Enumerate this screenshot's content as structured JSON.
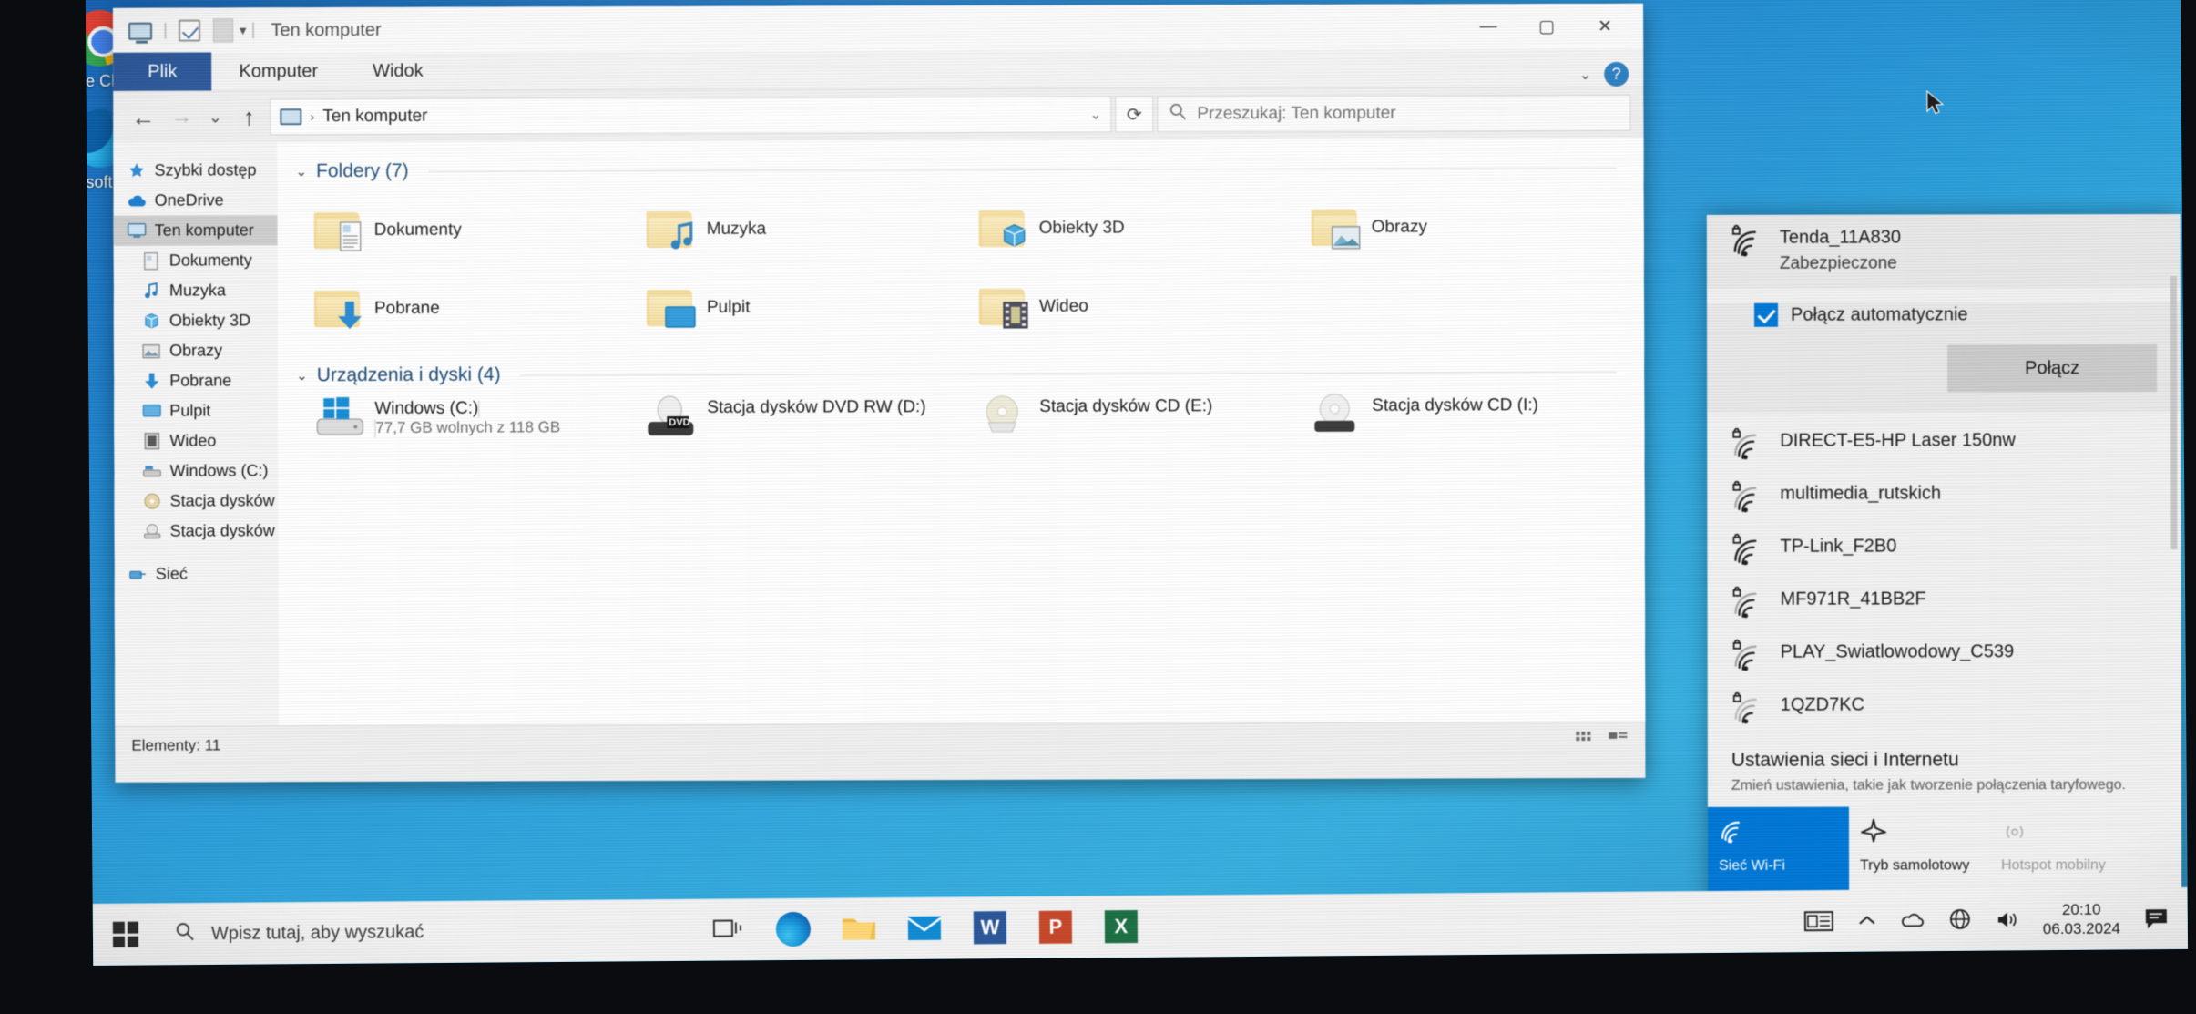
{
  "desktop": {
    "icons": [
      {
        "name": "Google Chrome",
        "icon": "chrome-icon"
      },
      {
        "name": "Microsoft Edge",
        "icon": "edge-icon"
      }
    ]
  },
  "explorer": {
    "titlebar": {
      "title": "Ten komputer",
      "quick_access_icons": [
        "this-pc-icon",
        "properties-icon",
        "new-folder-icon"
      ],
      "dropdown_caret": "▾",
      "separator": "|",
      "minimize": "—",
      "maximize": "▢",
      "close": "✕"
    },
    "ribbon": {
      "tabs": [
        {
          "label": "Plik",
          "active": true
        },
        {
          "label": "Komputer",
          "active": false
        },
        {
          "label": "Widok",
          "active": false
        }
      ],
      "collapse_caret": "⌄",
      "help_label": "?"
    },
    "address_bar": {
      "back": "←",
      "forward": "→",
      "recent": "⌄",
      "up": "↑",
      "path_icon": "this-pc-icon",
      "path_separator": "›",
      "path": "Ten komputer",
      "history_caret": "⌄",
      "refresh": "⟳"
    },
    "search": {
      "icon": "search-icon",
      "placeholder": "Przeszukaj: Ten komputer",
      "value": ""
    },
    "nav_pane": [
      {
        "label": "Szybki dostęp",
        "icon": "star-icon",
        "indent": false,
        "selected": false
      },
      {
        "label": "OneDrive",
        "icon": "cloud-icon",
        "indent": false,
        "selected": false
      },
      {
        "label": "Ten komputer",
        "icon": "this-pc-icon",
        "indent": false,
        "selected": true
      },
      {
        "label": "Dokumenty",
        "icon": "documents-icon",
        "indent": true,
        "selected": false
      },
      {
        "label": "Muzyka",
        "icon": "music-icon",
        "indent": true,
        "selected": false
      },
      {
        "label": "Obiekty 3D",
        "icon": "3d-objects-icon",
        "indent": true,
        "selected": false
      },
      {
        "label": "Obrazy",
        "icon": "pictures-icon",
        "indent": true,
        "selected": false
      },
      {
        "label": "Pobrane",
        "icon": "downloads-icon",
        "indent": true,
        "selected": false
      },
      {
        "label": "Pulpit",
        "icon": "desktop-icon",
        "indent": true,
        "selected": false
      },
      {
        "label": "Wideo",
        "icon": "videos-icon",
        "indent": true,
        "selected": false
      },
      {
        "label": "Windows (C:)",
        "icon": "hard-drive-icon",
        "indent": true,
        "selected": false
      },
      {
        "label": "Stacja dysków CD (I",
        "icon": "cd-drive-icon",
        "indent": true,
        "selected": false
      },
      {
        "label": "Stacja dysków CD (I",
        "icon": "cd-drive-icon",
        "indent": true,
        "selected": false
      },
      {
        "label": "Sieć",
        "icon": "network-icon",
        "indent": false,
        "selected": false
      }
    ],
    "groups": [
      {
        "header": "Foldery (7)",
        "chevron": "⌄",
        "items": [
          {
            "label": "Dokumenty",
            "icon": "folder-documents-icon"
          },
          {
            "label": "Muzyka",
            "icon": "folder-music-icon"
          },
          {
            "label": "Obiekty 3D",
            "icon": "folder-3d-icon"
          },
          {
            "label": "Obrazy",
            "icon": "folder-pictures-icon"
          },
          {
            "label": "Pobrane",
            "icon": "folder-downloads-icon"
          },
          {
            "label": "Pulpit",
            "icon": "folder-desktop-icon"
          },
          {
            "label": "Wideo",
            "icon": "folder-videos-icon"
          }
        ]
      },
      {
        "header": "Urządzenia i dyski (4)",
        "chevron": "⌄",
        "drives": [
          {
            "label": "Windows (C:)",
            "icon": "windows-drive-icon",
            "free_text": "77,7 GB wolnych z 118 GB",
            "used_percent": 34
          },
          {
            "label": "Stacja dysków DVD RW (D:)",
            "icon": "dvd-drive-icon",
            "free_text": "",
            "used_percent": 0
          },
          {
            "label": "Stacja dysków CD (E:)",
            "icon": "cd-disc-icon",
            "free_text": "",
            "used_percent": 0
          },
          {
            "label": "Stacja dysków CD (I:)",
            "icon": "cd-disc-icon",
            "free_text": "",
            "used_percent": 0
          }
        ]
      }
    ],
    "status": {
      "items_label": "Elementy: 11",
      "view_details_icon": "details-view-icon",
      "view_tiles_icon": "tiles-view-icon"
    }
  },
  "wifi_flyout": {
    "networks": [
      {
        "ssid": "Tenda_11A830",
        "status": "Zabezpieczone",
        "expanded": true,
        "secured": true,
        "bars": 4
      },
      {
        "ssid": "DIRECT-E5-HP Laser 150nw",
        "status": "",
        "expanded": false,
        "secured": true,
        "bars": 3
      },
      {
        "ssid": "multimedia_rutskich",
        "status": "",
        "expanded": false,
        "secured": true,
        "bars": 3
      },
      {
        "ssid": "TP-Link_F2B0",
        "status": "",
        "expanded": false,
        "secured": true,
        "bars": 4
      },
      {
        "ssid": "MF971R_41BB2F",
        "status": "",
        "expanded": false,
        "secured": true,
        "bars": 3
      },
      {
        "ssid": "PLAY_Swiatlowodowy_C539",
        "status": "",
        "expanded": false,
        "secured": true,
        "bars": 3
      },
      {
        "ssid": "1QZD7KC",
        "status": "",
        "expanded": false,
        "secured": true,
        "bars": 2
      }
    ],
    "auto_connect_label": "Połącz automatycznie",
    "auto_connect_checked": true,
    "connect_button": "Połącz",
    "settings_title": "Ustawienia sieci i Internetu",
    "settings_subtitle": "Zmień ustawienia, takie jak tworzenie połączenia taryfowego.",
    "quick_actions": [
      {
        "label": "Sieć Wi-Fi",
        "icon": "wifi-icon",
        "state": "on"
      },
      {
        "label": "Tryb samolotowy",
        "icon": "airplane-icon",
        "state": "off"
      },
      {
        "label": "Hotspot mobilny",
        "icon": "hotspot-icon",
        "state": "disabled"
      }
    ]
  },
  "taskbar": {
    "start_icon": "windows-start-icon",
    "search": {
      "icon": "search-icon",
      "placeholder": "Wpisz tutaj, aby wyszukać",
      "value": ""
    },
    "buttons": [
      {
        "name": "task-view-icon",
        "label": ""
      },
      {
        "name": "edge-icon",
        "label": ""
      },
      {
        "name": "file-explorer-icon",
        "label": ""
      },
      {
        "name": "mail-icon",
        "label": ""
      },
      {
        "name": "word-icon",
        "label": "W"
      },
      {
        "name": "powerpoint-icon",
        "label": "P"
      },
      {
        "name": "excel-icon",
        "label": "X"
      }
    ],
    "tray": {
      "news_icon": "news-and-interests-icon",
      "overflow_icon": "show-hidden-icons-icon",
      "onedrive_icon": "onedrive-tray-icon",
      "network_icon": "network-tray-icon",
      "volume_icon": "volume-icon",
      "time": "20:10",
      "date": "06.03.2024",
      "action_center_icon": "action-center-icon"
    }
  }
}
